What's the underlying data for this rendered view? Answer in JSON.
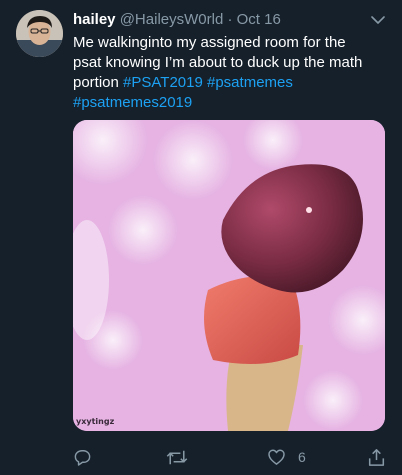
{
  "tweet": {
    "name": "hailey",
    "handle": "@HaileysW0rld",
    "dot": "·",
    "date": "Oct 16",
    "text_plain": "Me walkinginto my assigned room for the psat knowing I’m about to duck up the math portion ",
    "hashtags": [
      "#PSAT2019",
      "#psatmemes",
      "#psatmemes2019"
    ],
    "media_watermark": "yxytingz"
  },
  "actions": {
    "reply_icon": "reply-icon",
    "retweet_icon": "retweet-icon",
    "like_icon": "heart-icon",
    "like_count": "6",
    "share_icon": "share-icon"
  },
  "colors": {
    "background": "#15202b",
    "secondary_text": "#8899a6",
    "link": "#1da1f2"
  }
}
